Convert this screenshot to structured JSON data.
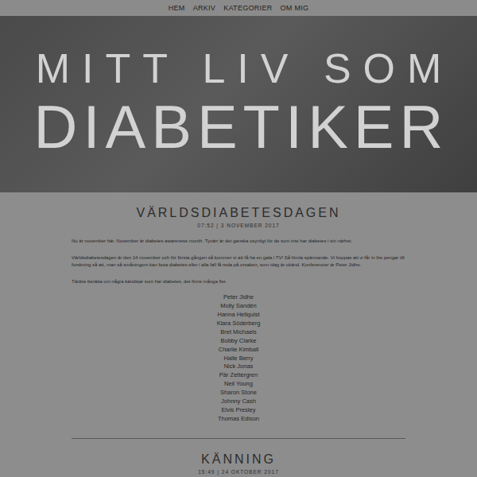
{
  "nav": [
    "HEM",
    "ARKIV",
    "KATEGORIER",
    "OM MIG"
  ],
  "header": {
    "title_line1": "MITT LIV SOM",
    "title_line2": "DIABETIKER"
  },
  "posts": [
    {
      "title": "VÄRLDSDIABETESDAGEN",
      "meta": "07:52 | 3 NOVEMBER 2017",
      "paragraphs": [
        "Nu är november här. November är diabetes awareness month. Tyvärr är det ganska osynligt för de som inte har diabetes i sin närhet.",
        "Världsdiabetesdagen är den 14 november och för första gången så kommer vi att få ha en gala i TV! Så himla spännande. Vi hoppas att vi får in lite pengar till forskning så att, man så småningom kan bota diabetes eller i alla fall få reda på orsaken, som idag är okänd. Konferencier är Peter Jidhe.",
        "Tänkte berätta om några kändisar som har diabetes, det finns många fler."
      ],
      "list": [
        "Peter Jidhe",
        "Molly Sandén",
        "Hanna Hellquist",
        "Klara Söderberg",
        "Bret Michaels",
        "Bobby Clarke",
        "Charlie Kimball",
        "Halle Berry",
        "Nick Jonas",
        "Pär Zettergren",
        "Neil Young",
        "Sharon Stone",
        "Johnny Cash",
        "Elvis Presley",
        "Thomas Edison"
      ]
    },
    {
      "title": "KÄNNING",
      "meta": "15:49 | 24 OKTOBER 2017",
      "paragraphs": [],
      "list": []
    }
  ]
}
